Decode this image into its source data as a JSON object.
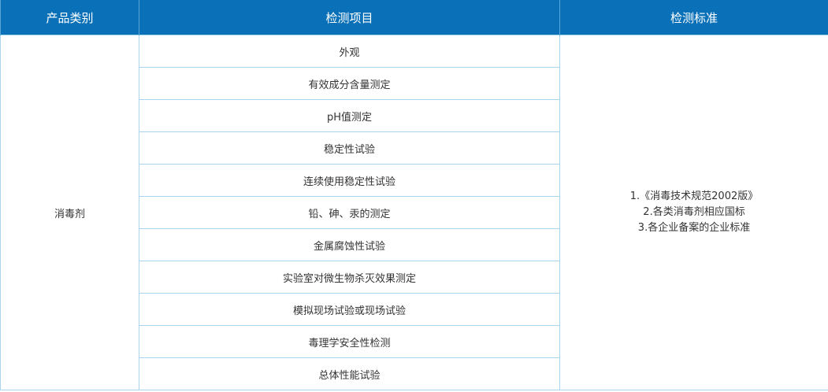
{
  "headers": {
    "category": "产品类别",
    "items": "检测项目",
    "standards": "检测标准"
  },
  "category": "消毒剂",
  "items": [
    "外观",
    "有效成分含量测定",
    "pH值测定",
    "稳定性试验",
    "连续使用稳定性试验",
    "铅、砷、汞的测定",
    "金属腐蚀性试验",
    "实验室对微生物杀灭效果测定",
    "模拟现场试验或现场试验",
    "毒理学安全性检测",
    "总体性能试验"
  ],
  "standards": [
    "1.《消毒技术规范2002版》",
    "2.各类消毒剂相应国标",
    "3.各企业备案的企业标准"
  ],
  "colors": {
    "header_bg": "#0a71b8",
    "header_text": "#ffffff",
    "border": "#a9d4ef",
    "body_text": "#333333"
  }
}
